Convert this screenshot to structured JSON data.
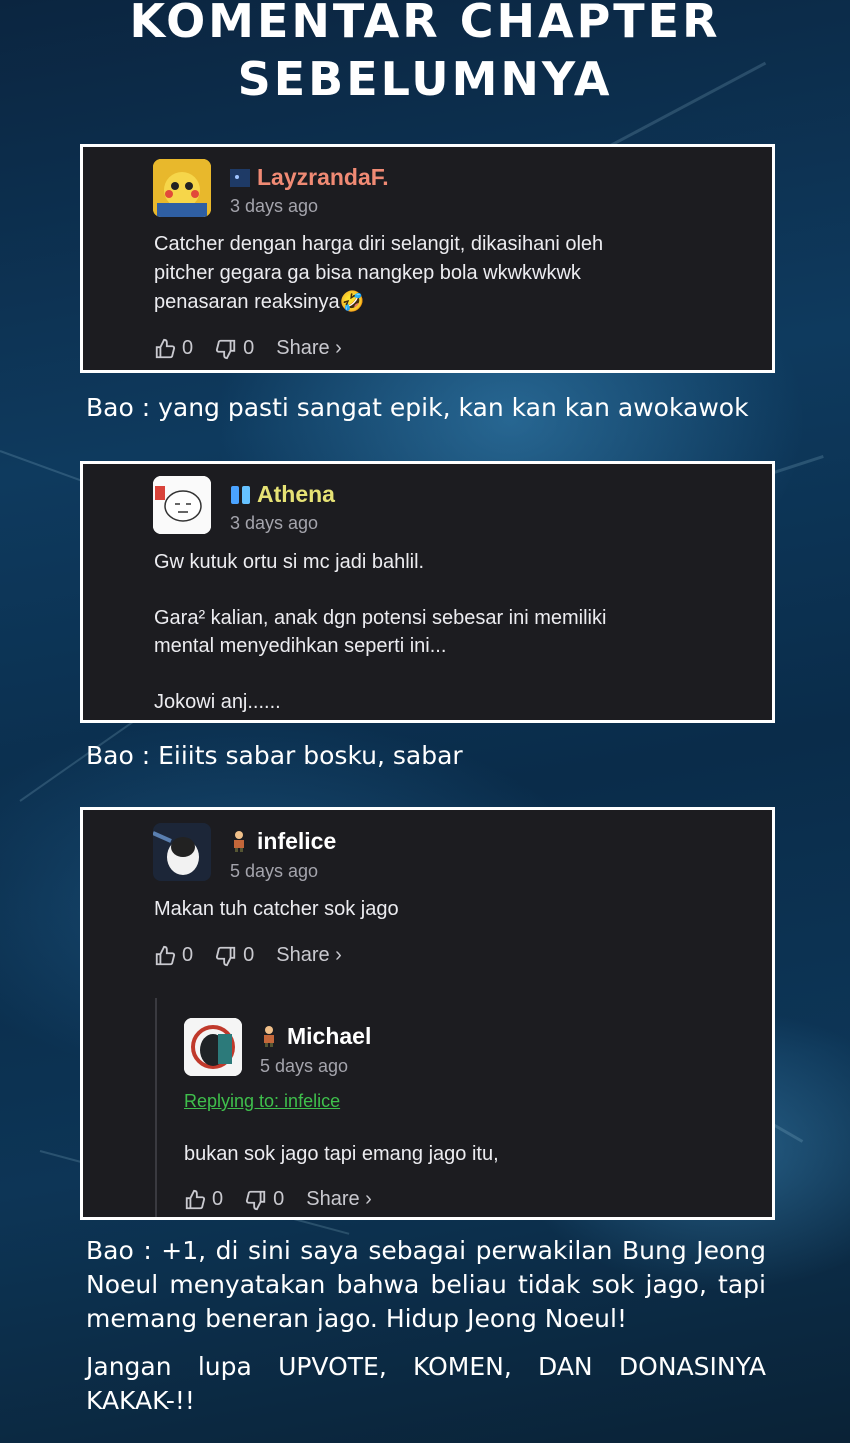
{
  "title": {
    "line1": "KOMENTAR CHAPTER",
    "line2": "SEBELUMNYA"
  },
  "comments": [
    {
      "username": "LayzrandaF.",
      "username_color": "#f08a74",
      "flag_icon": "badge-icon",
      "time": "3 days ago",
      "text": "Catcher dengan harga diri selangit, dikasihani oleh\npitcher gegara ga bisa nangkep bola wkwkwkwk\npenasaran reaksinya🤣",
      "likes": "0",
      "dislikes": "0",
      "share": "Share ›"
    },
    {
      "username": "Athena",
      "username_color": "#e6e275",
      "flag_icon": "sparkle-badge-icon",
      "time": "3 days ago",
      "text": "Gw kutuk ortu si mc jadi bahlil.\n\nGara² kalian, anak dgn potensi sebesar ini memiliki\nmental menyedihkan seperti ini...\n\nJokowi anj......"
    },
    {
      "username": "infelice",
      "username_color": "#ffffff",
      "flag_icon": "person-badge-icon",
      "time": "5 days ago",
      "text": "Makan tuh catcher sok jago",
      "likes": "0",
      "dislikes": "0",
      "share": "Share ›",
      "reply": {
        "username": "Michael",
        "username_color": "#ffffff",
        "flag_icon": "person-badge-icon",
        "time": "5 days ago",
        "replying_to": "Replying to: infelice",
        "text": "bukan sok jago tapi emang jago itu,",
        "likes": "0",
        "dislikes": "0",
        "share": "Share ›"
      }
    }
  ],
  "captions": {
    "c1": "Bao : yang pasti sangat epik, kan kan kan awokawok",
    "c2": "Bao : Eiiits sabar bosku, sabar",
    "c3": "Bao : +1, di sini saya sebagai perwakilan Bung Jeong Noeul menyatakan bahwa beliau tidak sok jago, tapi memang beneran jago. Hidup Jeong Noeul!",
    "c4": "Jangan lupa UPVOTE, KOMEN, DAN DONASINYA KAKAK-!!"
  }
}
